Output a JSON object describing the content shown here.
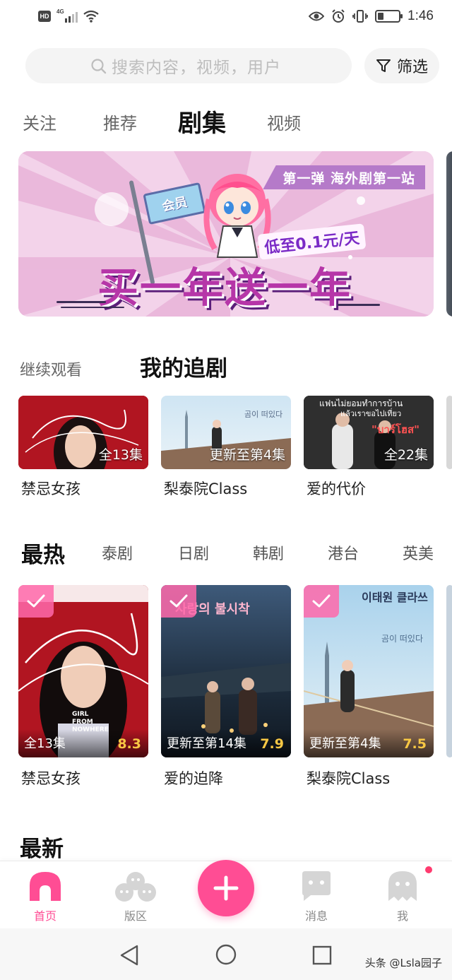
{
  "status_bar": {
    "hd": "HD",
    "net": "4G",
    "time": "1:46",
    "battery_level": 0.3
  },
  "search": {
    "placeholder": "搜索内容，视频，用户",
    "filter_label": "筛选"
  },
  "top_tabs": [
    {
      "label": "关注",
      "active": false
    },
    {
      "label": "推荐",
      "active": false
    },
    {
      "label": "剧集",
      "active": true
    },
    {
      "label": "视频",
      "active": false
    }
  ],
  "banner": {
    "tag": "第一弹 海外剧第一站",
    "badge": "会员",
    "price": "低至0.1元/天",
    "headline": "买一年送一年"
  },
  "follow_section": {
    "continue_label": "继续观看",
    "title": "我的追剧",
    "items": [
      {
        "title": "禁忌女孩",
        "badge": "全13集"
      },
      {
        "title": "梨泰院Class",
        "badge": "更新至第4集"
      },
      {
        "title": "爱的代价",
        "badge": "全22集",
        "poster_text_top": "แฟนไม่ยอมทำการบ้าน",
        "poster_text_mid": "แล้วเราขอไปเที่ยว",
        "poster_text_red": "\"บาร์โฮส\""
      }
    ]
  },
  "hot_section": {
    "title": "最热",
    "categories": [
      "泰剧",
      "日剧",
      "韩剧",
      "港台",
      "英美"
    ],
    "items": [
      {
        "title": "禁忌女孩",
        "episodes": "全13集",
        "score": "8.3",
        "poster_text": "GIRL FROM NOWHERE"
      },
      {
        "title": "爱的迫降",
        "episodes": "更新至第14集",
        "score": "7.9"
      },
      {
        "title": "梨泰院Class",
        "episodes": "更新至第4集",
        "score": "7.5",
        "poster_text": "이태원 클라쓰"
      }
    ]
  },
  "latest_section": {
    "title": "最新"
  },
  "bottom_nav": {
    "items": [
      {
        "label": "首页",
        "icon": "home-icon",
        "active": true
      },
      {
        "label": "版区",
        "icon": "community-icon",
        "active": false
      },
      {
        "label": "消息",
        "icon": "message-icon",
        "active": false
      },
      {
        "label": "我",
        "icon": "profile-icon",
        "active": false
      }
    ],
    "accent": "#ff4d94"
  },
  "watermark": "头条 @Lsla园子"
}
